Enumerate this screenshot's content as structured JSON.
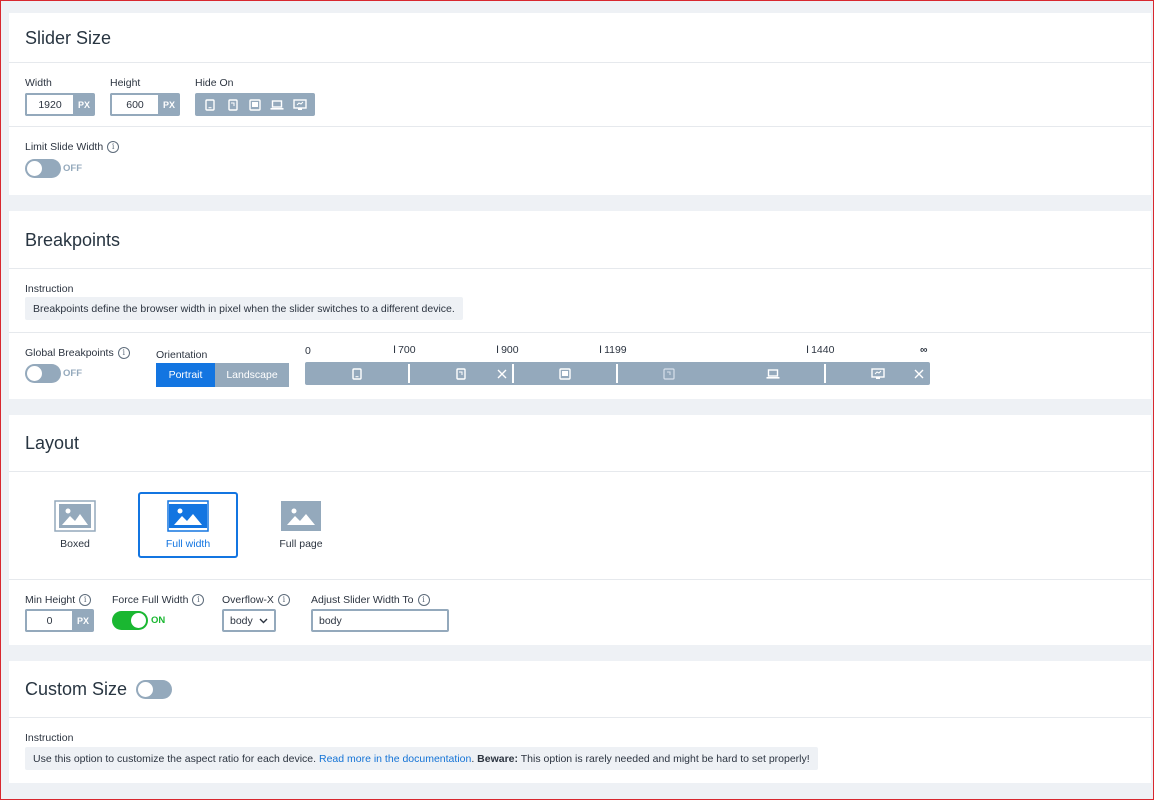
{
  "slider_size": {
    "title": "Slider Size",
    "width_label": "Width",
    "width_value": "1920",
    "width_unit": "PX",
    "height_label": "Height",
    "height_value": "600",
    "height_unit": "PX",
    "hide_on_label": "Hide On",
    "limit_label": "Limit Slide Width",
    "limit_state": "OFF"
  },
  "breakpoints": {
    "title": "Breakpoints",
    "instruction_label": "Instruction",
    "instruction_text": "Breakpoints define the browser width in pixel when the slider switches to a different device.",
    "global_label": "Global Breakpoints",
    "global_state": "OFF",
    "orientation_label": "Orientation",
    "portrait": "Portrait",
    "landscape": "Landscape",
    "scale": [
      "0",
      "700",
      "900",
      "1199",
      "1440",
      "∞"
    ]
  },
  "layout": {
    "title": "Layout",
    "options": [
      {
        "label": "Boxed",
        "selected": false
      },
      {
        "label": "Full width",
        "selected": true
      },
      {
        "label": "Full page",
        "selected": false
      }
    ],
    "min_height_label": "Min Height",
    "min_height_value": "0",
    "min_height_unit": "PX",
    "force_label": "Force Full Width",
    "force_state": "ON",
    "overflow_label": "Overflow-X",
    "overflow_value": "body",
    "adjust_label": "Adjust Slider Width To",
    "adjust_value": "body"
  },
  "custom_size": {
    "title": "Custom Size",
    "instruction_label": "Instruction",
    "text_before": "Use this option to customize the aspect ratio for each device. ",
    "link_text": "Read more in the documentation",
    "text_mid": ". ",
    "beware": "Beware:",
    "text_after": " This option is rarely needed and might be hard to set properly!"
  },
  "colors": {
    "accent": "#1375e1",
    "muted": "#94a9bc",
    "on": "#1ab731"
  }
}
